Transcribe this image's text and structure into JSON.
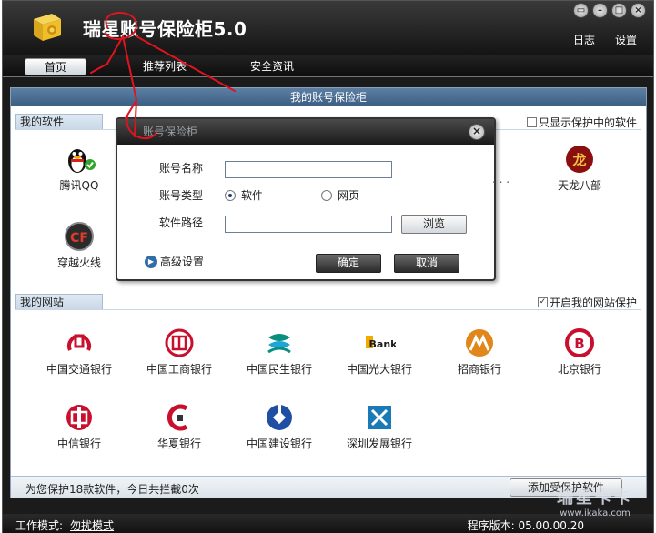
{
  "app": {
    "title": "瑞星账号保险柜5.0"
  },
  "window_controls": [
    "restore",
    "minimize",
    "maximize",
    "close"
  ],
  "top_links": {
    "log": "日志",
    "settings": "设置"
  },
  "tabs": [
    {
      "label": "首页",
      "active": true
    },
    {
      "label": "推荐列表",
      "active": false
    },
    {
      "label": "安全资讯",
      "active": false
    }
  ],
  "main": {
    "header": "我的账号保险柜",
    "software_section": {
      "label": "我的软件",
      "filter_label": "只显示保护中的软件",
      "filter_checked": false,
      "items": [
        {
          "label": "腾讯QQ",
          "icon": "qq-penguin-icon",
          "protected": true
        },
        {
          "label": "穿越火线",
          "icon": "crossfire-icon"
        },
        {
          "label": "天龙八部",
          "icon": "tianlong-icon"
        }
      ]
    },
    "website_section": {
      "label": "我的网站",
      "toggle_label": "开启我的网站保护",
      "toggle_checked": true,
      "banks": [
        {
          "label": "中国交通银行",
          "icon": "bocom-icon",
          "color": "#c8102e"
        },
        {
          "label": "中国工商银行",
          "icon": "icbc-icon",
          "color": "#c8102e"
        },
        {
          "label": "中国民生银行",
          "icon": "cmbc-icon",
          "color": "#0a8f7f"
        },
        {
          "label": "中国光大银行",
          "icon": "ceb-icon",
          "color": "#f2a900",
          "logo_text": "Bank"
        },
        {
          "label": "招商银行",
          "icon": "cmb-icon",
          "color": "#e0861a"
        },
        {
          "label": "北京银行",
          "icon": "bob-icon",
          "color": "#c8102e"
        },
        {
          "label": "中信银行",
          "icon": "citic-icon",
          "color": "#c8102e"
        },
        {
          "label": "华夏银行",
          "icon": "hxb-icon",
          "color": "#c8102e"
        },
        {
          "label": "中国建设银行",
          "icon": "ccb-icon",
          "color": "#1f4fa3"
        },
        {
          "label": "深圳发展银行",
          "icon": "sdb-icon",
          "color": "#1a7ab8"
        }
      ]
    },
    "status": {
      "text": "为您保护18款软件，今日共拦截0次",
      "add_button": "添加受保护软件"
    }
  },
  "footer": {
    "work_mode_label": "工作模式:",
    "work_mode_value": "勿扰模式",
    "version": "程序版本: 05.00.00.20",
    "watermark_big": "瑞星卡卡",
    "watermark_small": "www.ikaka.com"
  },
  "dialog": {
    "title": "账号保险柜",
    "account_name_label": "账号名称",
    "account_name_value": "",
    "account_type_label": "账号类型",
    "type_options": [
      {
        "label": "软件",
        "selected": true
      },
      {
        "label": "网页",
        "selected": false
      }
    ],
    "software_path_label": "软件路径",
    "software_path_value": "",
    "browse_button": "浏览",
    "advanced": "高级设置",
    "ok_button": "确定",
    "cancel_button": "取消",
    "hidden_fragment": ". . ."
  },
  "colors": {
    "accent": "#3b5d82",
    "annotation": "#e0141e"
  }
}
